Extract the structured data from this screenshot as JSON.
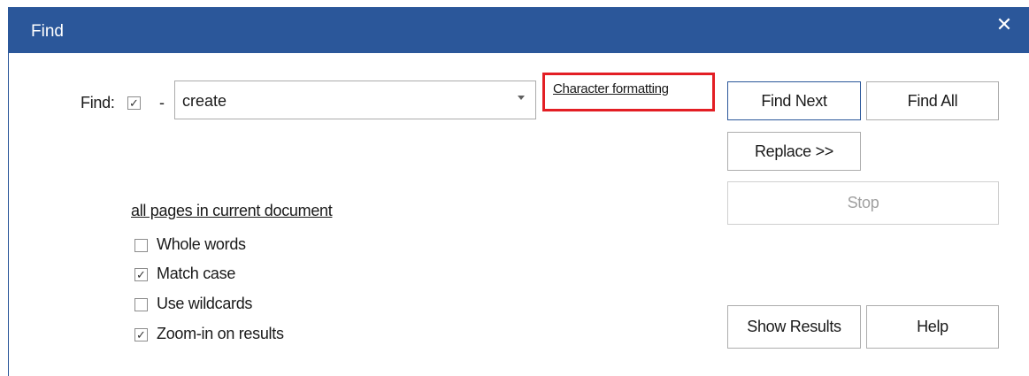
{
  "window": {
    "title": "Find",
    "close_glyph": "✕"
  },
  "find": {
    "label": "Find:",
    "checkbox_checked": true,
    "dash": "-",
    "value": "create",
    "character_formatting_link": "Character formatting"
  },
  "scope": {
    "link": "all pages in current document"
  },
  "options": [
    {
      "label": "Whole words",
      "checked": false
    },
    {
      "label": "Match case",
      "checked": true
    },
    {
      "label": "Use wildcards",
      "checked": false
    },
    {
      "label": "Zoom-in on results",
      "checked": true
    }
  ],
  "buttons": {
    "find_next": "Find Next",
    "find_all": "Find All",
    "replace": "Replace >>",
    "stop": "Stop",
    "show_results": "Show Results",
    "help": "Help"
  },
  "colors": {
    "titlebar": "#2b579a",
    "highlight_box": "#e31e24"
  }
}
